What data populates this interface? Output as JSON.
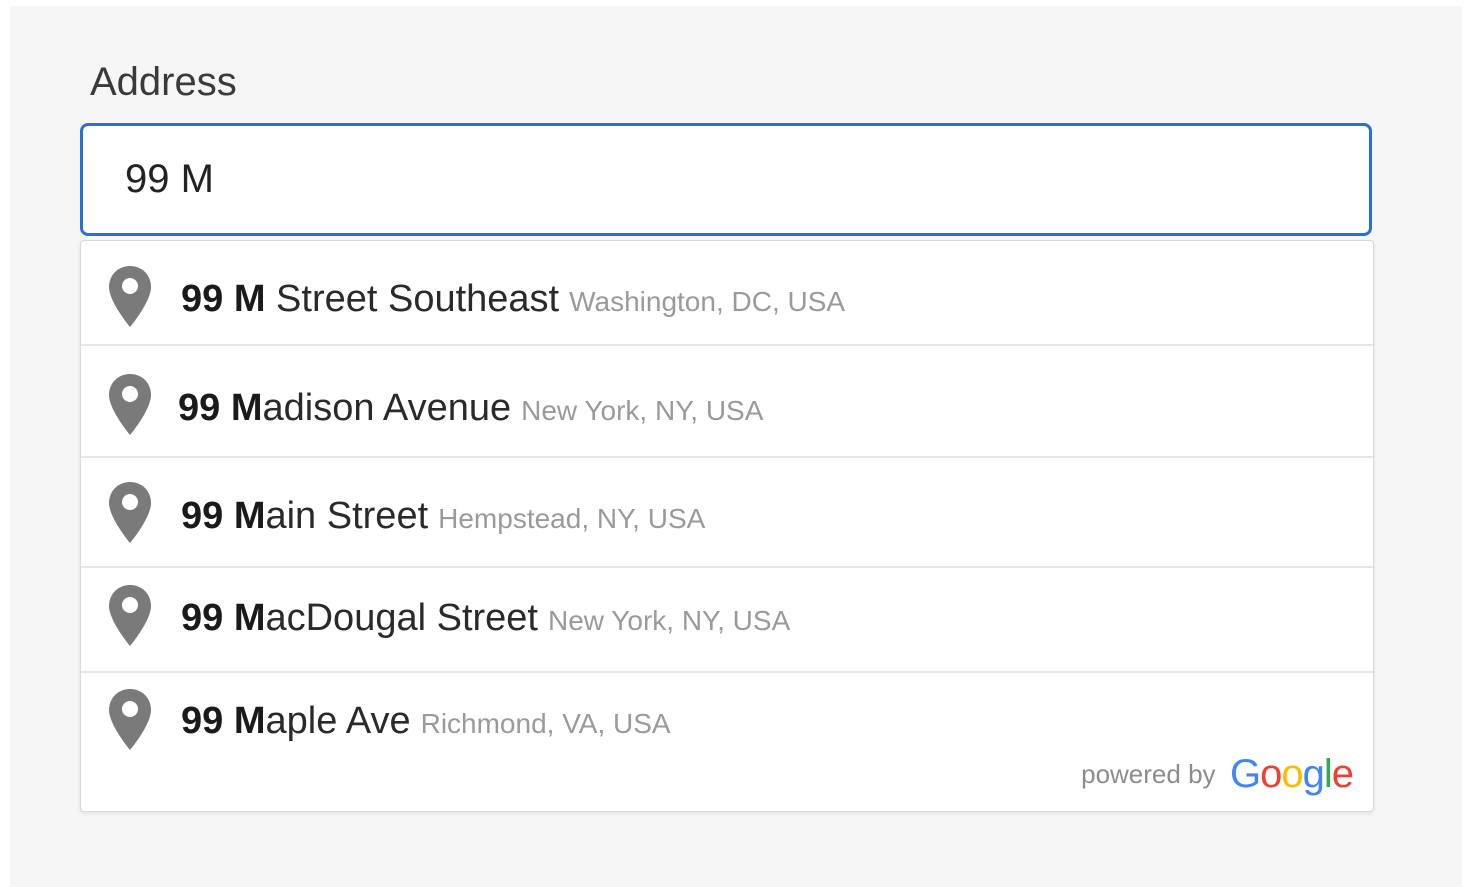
{
  "field": {
    "label": "Address",
    "value": "99 M"
  },
  "suggestions": [
    {
      "match": "99 M",
      "rest": " Street Southeast",
      "secondary": "Washington, DC, USA"
    },
    {
      "match": "99 M",
      "rest": "adison Avenue",
      "secondary": "New York, NY, USA"
    },
    {
      "match": "99 M",
      "rest": "ain Street",
      "secondary": "Hempstead, NY, USA"
    },
    {
      "match": "99 M",
      "rest": "acDougal Street",
      "secondary": "New York, NY, USA"
    },
    {
      "match": "99 M",
      "rest": "aple Ave",
      "secondary": "Richmond, VA, USA"
    }
  ],
  "attribution": {
    "powered_by": "powered by",
    "logo_letters": [
      "G",
      "o",
      "o",
      "g",
      "l",
      "e"
    ]
  },
  "icons": {
    "suggestion_icon": "map-pin-icon"
  },
  "colors": {
    "focus_border": "#2a6fd6",
    "pin": "#7a7a7a",
    "google_blue": "#4285F4",
    "google_red": "#EA4335",
    "google_yellow": "#FBBC05",
    "google_green": "#34A853"
  }
}
